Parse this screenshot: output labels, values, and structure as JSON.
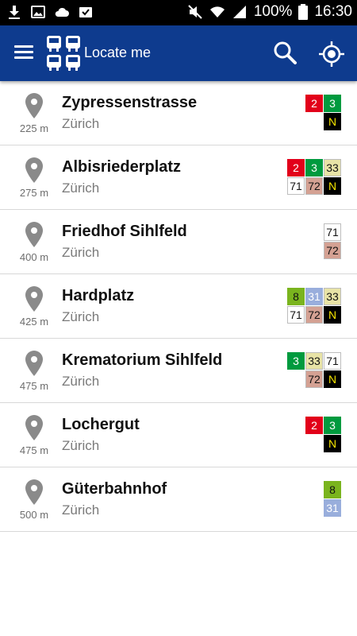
{
  "status_bar": {
    "battery_percent": "100%",
    "time": "16:30",
    "icons": [
      "download-icon",
      "image-icon",
      "cloud-icon",
      "tasks-icon",
      "mute-icon",
      "wifi-icon",
      "signal-icon",
      "battery-icon"
    ]
  },
  "app_bar": {
    "title": "Locate me",
    "icons": [
      "menu-icon",
      "transit-logo-icon",
      "search-icon",
      "gps-locate-icon"
    ]
  },
  "colors": {
    "app_bar": "#0e3b8e",
    "line_2": "#e2001a",
    "line_3": "#009a3e",
    "line_N": "#000000",
    "line_N_text": "#f5e400",
    "line_33": "#e8e3a6",
    "line_71": "#ffffff",
    "line_72": "#d4a193",
    "line_8": "#7ab41e",
    "line_31": "#99aedc"
  },
  "stops": [
    {
      "name": "Zypressenstrasse",
      "city": "Zürich",
      "distance": "225 m",
      "lines": [
        [
          "2",
          "3"
        ],
        [
          "N"
        ]
      ]
    },
    {
      "name": "Albisriederplatz",
      "city": "Zürich",
      "distance": "275 m",
      "lines": [
        [
          "2",
          "3",
          "33"
        ],
        [
          "71",
          "72",
          "N"
        ]
      ]
    },
    {
      "name": "Friedhof Sihlfeld",
      "city": "Zürich",
      "distance": "400 m",
      "lines": [
        [
          "71"
        ],
        [
          "72"
        ]
      ]
    },
    {
      "name": "Hardplatz",
      "city": "Zürich",
      "distance": "425 m",
      "lines": [
        [
          "8",
          "31",
          "33"
        ],
        [
          "71",
          "72",
          "N"
        ]
      ]
    },
    {
      "name": "Krematorium Sihlfeld",
      "city": "Zürich",
      "distance": "475 m",
      "lines": [
        [
          "3",
          "33",
          "71"
        ],
        [
          "72",
          "N"
        ]
      ]
    },
    {
      "name": "Lochergut",
      "city": "Zürich",
      "distance": "475 m",
      "lines": [
        [
          "2",
          "3"
        ],
        [
          "N"
        ]
      ]
    },
    {
      "name": "Güterbahnhof",
      "city": "Zürich",
      "distance": "500 m",
      "lines": [
        [
          "8"
        ],
        [
          "31"
        ]
      ]
    }
  ]
}
